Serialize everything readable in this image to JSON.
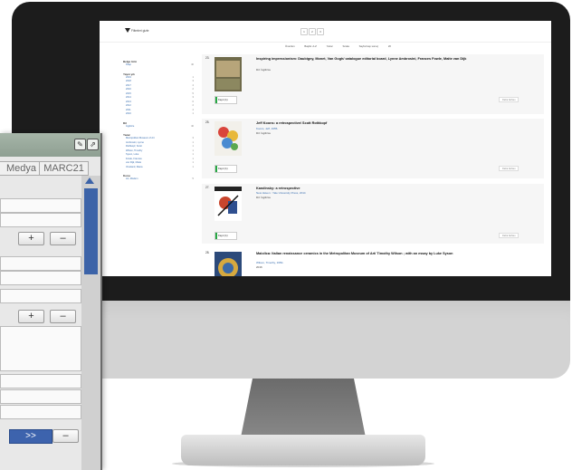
{
  "screen": {
    "filter_label": "Filtreleri gizle",
    "pager": [
      "1",
      "2",
      "3"
    ],
    "sort_options": [
      "Önerilen",
      "Başlık: A-Z",
      "Yazar",
      "Sırala",
      "Sayfa başı sonuç",
      "20"
    ],
    "facets": [
      {
        "title": "Belge türü",
        "items": [
          {
            "label": "Kitap",
            "count": "40"
          }
        ]
      },
      {
        "title": "Yayın yılı",
        "items": [
          {
            "label": "2019",
            "count": "1"
          },
          {
            "label": "2018",
            "count": "3"
          },
          {
            "label": "2017",
            "count": "4"
          },
          {
            "label": "2016",
            "count": "2"
          },
          {
            "label": "2015",
            "count": "5"
          },
          {
            "label": "2014",
            "count": "3"
          },
          {
            "label": "2013",
            "count": "6"
          },
          {
            "label": "2012",
            "count": "2"
          },
          {
            "label": "2011",
            "count": "4"
          },
          {
            "label": "2010",
            "count": "1"
          }
        ]
      },
      {
        "title": "Dil",
        "items": [
          {
            "label": "İngilizce",
            "count": "40"
          }
        ]
      },
      {
        "title": "Yazar",
        "items": [
          {
            "label": "Metropolitan Museum of Art",
            "count": "3"
          },
          {
            "label": "Ambrosini, Lynne",
            "count": "1"
          },
          {
            "label": "Rothkopf, Scott",
            "count": "1"
          },
          {
            "label": "Wilson, Timothy",
            "count": "1"
          },
          {
            "label": "Syson, Luke",
            "count": "1"
          },
          {
            "label": "Fowle, Frances",
            "count": "1"
          },
          {
            "label": "van Dijk, Maite",
            "count": "1"
          },
          {
            "label": "Vreeland, Diana",
            "count": "1"
          }
        ]
      },
      {
        "title": "Konu",
        "items": [
          {
            "label": "Art, Modern",
            "count": "5"
          }
        ]
      }
    ],
    "results": [
      {
        "num": "23.",
        "title": "Inspiring impressionism: Daubigny, Monet, Van Gogh/ catalogue editorial board, Lynne Ambrosini, Frances Fowle, Maite van Dijk",
        "author": "",
        "type": "Dil: İngilizce",
        "button": "Kayıt (1)",
        "more": "Daha fazlası"
      },
      {
        "num": "25.",
        "title": "Jeff Koons: a retrospective/ Scott Rothkopf",
        "author": "Koons, Jeff, 1955-",
        "type": "Dil: İngilizce",
        "button": "Kayıt (1)",
        "more": "Daha fazlası"
      },
      {
        "num": "27.",
        "title": "Kandinsky: a retrospective",
        "author": "New Haven : Yale University Press, 2014",
        "type": "Dil: İngilizce",
        "button": "Kayıt (1)",
        "more": "Daha fazlası"
      },
      {
        "num": "28.",
        "title": "Maiolica: Italian renaissance ceramics in the Metropolitan Museum of Art/ Timothy Wilson ; with an essay by Luke Syson",
        "author": "Wilson, Timothy, 1950-",
        "type": "2016",
        "button": "",
        "more": ""
      }
    ]
  },
  "panel": {
    "tabs": [
      "Medya",
      "MARC21"
    ],
    "add": "+",
    "remove": "–",
    "forward": ">>"
  },
  "colors": {
    "accent_blue": "#3c63a8",
    "available_green": "#27a844",
    "bezel": "#1c1c1c"
  }
}
